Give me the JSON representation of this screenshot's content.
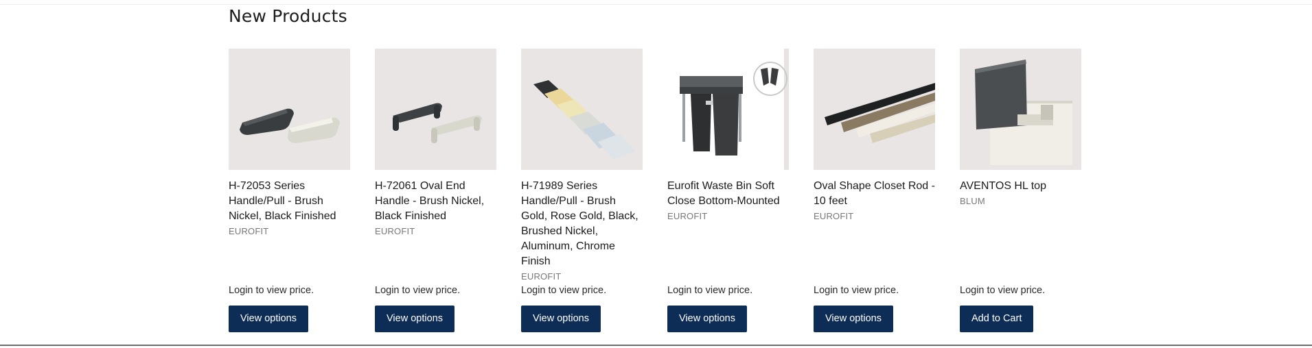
{
  "section": {
    "title": "New Products"
  },
  "products": [
    {
      "name": "H-72053 Series Handle/Pull - Brush Nickel, Black Finished",
      "brand": "EUROFIT",
      "price_text": "Login to view price.",
      "button": "View options"
    },
    {
      "name": "H-72061 Oval End Handle - Brush Nickel, Black Finished",
      "brand": "EUROFIT",
      "price_text": "Login to view price.",
      "button": "View options"
    },
    {
      "name": "H-71989 Series Handle/Pull - Brush Gold, Rose Gold, Black, Brushed Nickel, Aluminum, Chrome Finish",
      "brand": "EUROFIT",
      "price_text": "Login to view price.",
      "button": "View options"
    },
    {
      "name": "Eurofit Waste Bin Soft Close Bottom-Mounted",
      "brand": "EUROFIT",
      "price_text": "Login to view price.",
      "button": "View options"
    },
    {
      "name": "Oval Shape Closet Rod - 10 feet",
      "brand": "EUROFIT",
      "price_text": "Login to view price.",
      "button": "View options"
    },
    {
      "name": "AVENTOS HL top",
      "brand": "BLUM",
      "price_text": "Login to view price.",
      "button": "Add to Cart"
    }
  ],
  "colors": {
    "button_bg": "#0d2d57",
    "button_text": "#ffffff",
    "image_bg": "#e9e5e4",
    "brand_text": "#777777"
  }
}
